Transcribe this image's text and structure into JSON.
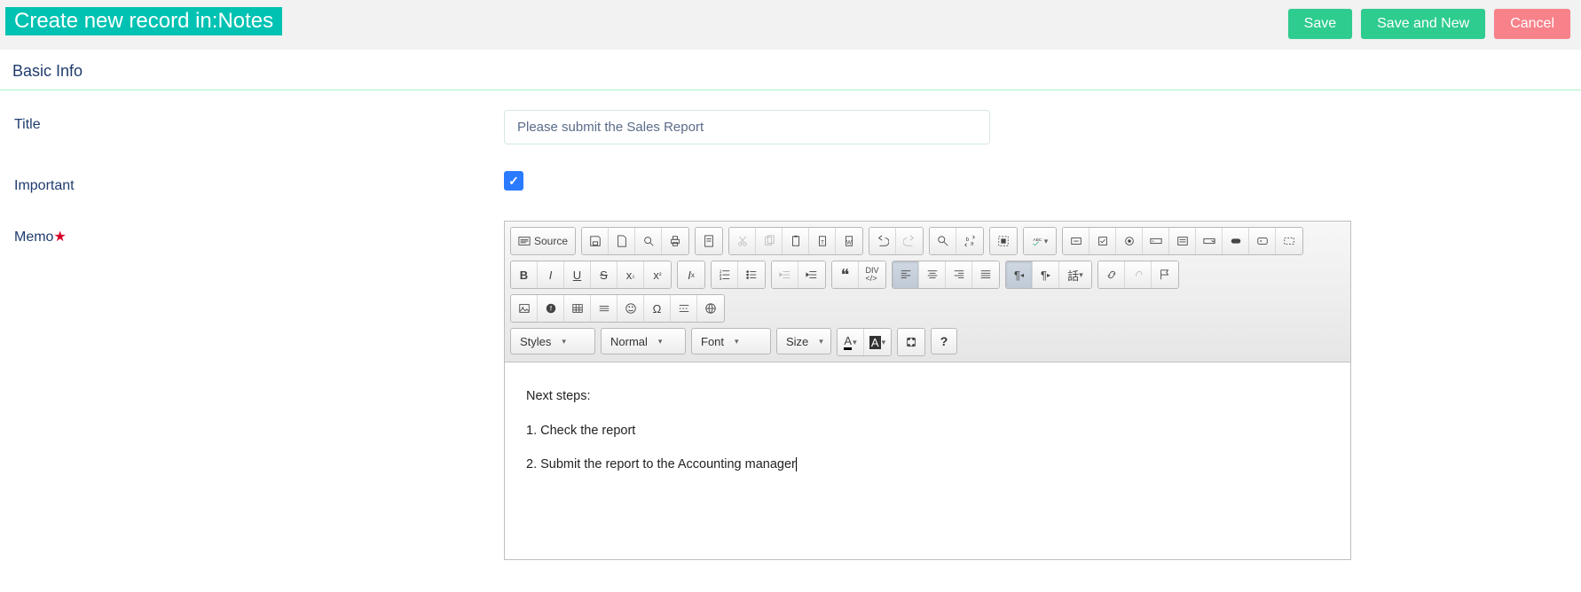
{
  "header": {
    "tag": "Create new record in:Notes",
    "save": "Save",
    "saveNew": "Save and New",
    "cancel": "Cancel"
  },
  "section": "Basic Info",
  "fields": {
    "titleLabel": "Title",
    "titleValue": "Please submit the Sales Report",
    "importantLabel": "Important",
    "memoLabel": "Memo"
  },
  "toolbar": {
    "source": "Source",
    "styles": "Styles",
    "format": "Normal",
    "font": "Font",
    "size": "Size"
  },
  "memo": {
    "l1": "Next steps:",
    "l2": "1. Check the report",
    "l3": "2. Submit the report to the Accounting manager"
  }
}
